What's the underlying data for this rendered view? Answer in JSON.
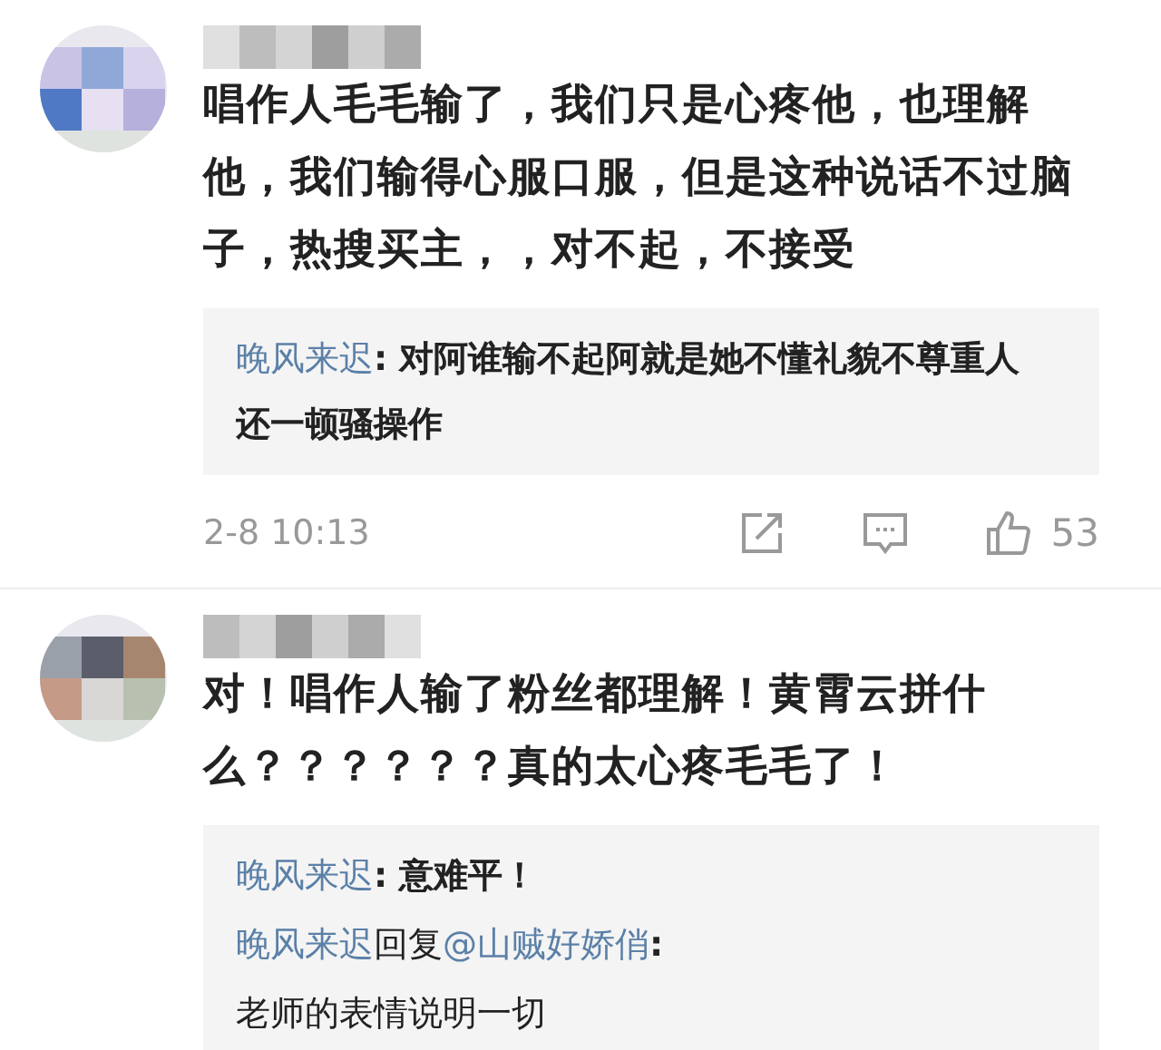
{
  "comments": [
    {
      "text": "唱作人毛毛输了，我们只是心疼他，也理解他，我们输得心服口服，但是这种说话不过脑子，热搜买主，，对不起，不接受",
      "replies": [
        {
          "user": "晚风来迟",
          "text": ": 对阿谁输不起阿就是她不懂礼貌不尊重人还一顿骚操作"
        }
      ],
      "time": "2-8 10:13",
      "likes": "53"
    },
    {
      "text": "对！唱作人输了粉丝都理解！黄霄云拼什么？？？？？？真的太心疼毛毛了！",
      "replies": [
        {
          "user": "晚风来迟",
          "text": ": 意难平！"
        },
        {
          "user": "晚风来迟",
          "reply_word": "回复",
          "mention": "@山贼好娇俏",
          "text": ":",
          "continuation": "老师的表情说明一切"
        }
      ]
    }
  ]
}
